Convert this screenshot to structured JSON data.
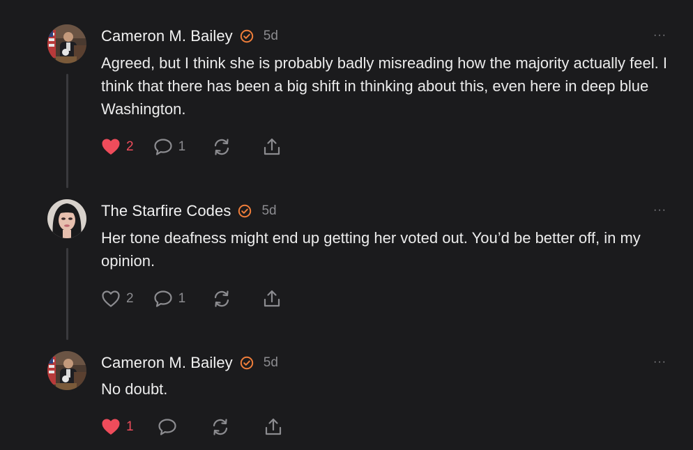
{
  "comments": [
    {
      "author": "Cameron M. Bailey",
      "time": "5d",
      "text": "Agreed, but I think she is probably badly misreading how the majority actually feel. I think that there has been a big shift in thinking about this, even here in deep blue Washington.",
      "likes": "2",
      "liked": true,
      "replies": "1",
      "avatar": "cameron-avatar"
    },
    {
      "author": "The Starfire Codes",
      "time": "5d",
      "text": "Her tone deafness might end up getting her voted out. You’d be better off, in my opinion.",
      "likes": "2",
      "liked": false,
      "replies": "1",
      "avatar": "starfire-avatar"
    },
    {
      "author": "Cameron M. Bailey",
      "time": "5d",
      "text": "No doubt.",
      "likes": "1",
      "liked": true,
      "replies": "",
      "avatar": "cameron-avatar"
    }
  ],
  "more_label": "···",
  "colors": {
    "background": "#1b1b1d",
    "verified": "#f07e3a",
    "like": "#ef4c5b",
    "muted": "#8c8c90",
    "thread_line": "#3a3a3d"
  }
}
